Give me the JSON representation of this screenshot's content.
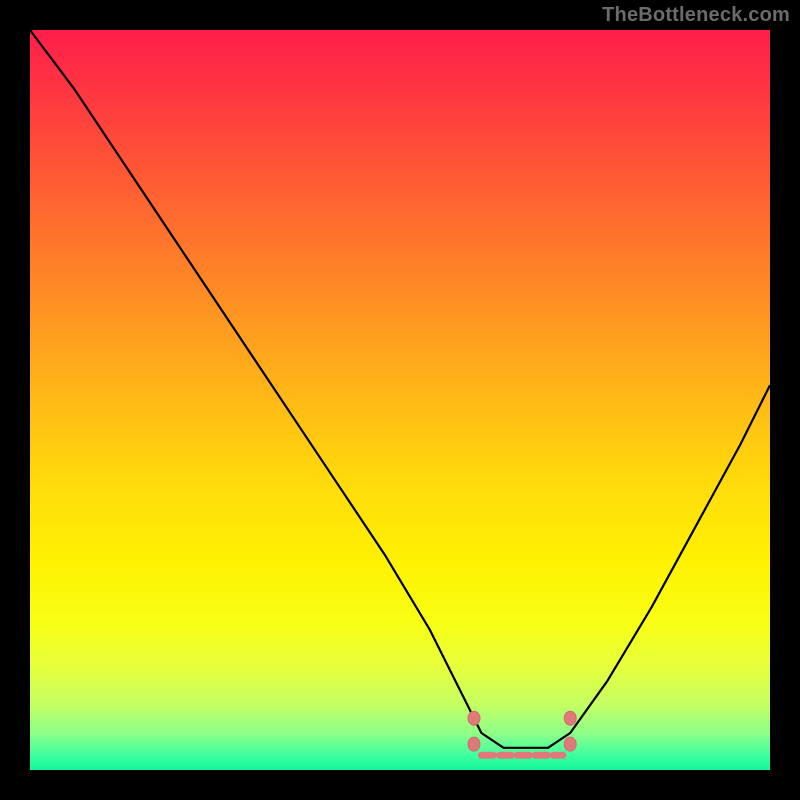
{
  "watermark": "TheBottleneck.com",
  "colors": {
    "page_bg": "#000000",
    "curve": "#000000",
    "marker": "#e07a7a",
    "gradient_top": "#ff1e4b",
    "gradient_bottom": "#12f79a"
  },
  "chart_data": {
    "type": "line",
    "title": "",
    "xlabel": "",
    "ylabel": "",
    "xlim": [
      0,
      100
    ],
    "ylim": [
      0,
      100
    ],
    "note": "Values are estimated from pixel positions; chart has no numeric axis labels. y=0 is the bottom (green, optimal), y=100 is the top (red, worst).",
    "series": [
      {
        "name": "bottleneck-curve",
        "x": [
          0,
          6,
          12,
          18,
          24,
          30,
          36,
          42,
          48,
          54,
          59,
          61,
          64,
          67,
          70,
          73,
          78,
          84,
          90,
          96,
          100
        ],
        "y": [
          100,
          92,
          83,
          74,
          65,
          56,
          47,
          38,
          29,
          19,
          9,
          5,
          3,
          3,
          3,
          5,
          12,
          22,
          33,
          44,
          52
        ]
      }
    ],
    "optimal_range_x": [
      60,
      73
    ],
    "markers": [
      {
        "name": "range-start-top",
        "x": 60,
        "y": 7
      },
      {
        "name": "range-start-bottom",
        "x": 60,
        "y": 3.5
      },
      {
        "name": "range-end-top",
        "x": 73,
        "y": 7
      },
      {
        "name": "range-end-bottom",
        "x": 73,
        "y": 3.5
      }
    ],
    "bottom_dash": {
      "x0": 61,
      "x1": 72,
      "y": 2
    }
  }
}
